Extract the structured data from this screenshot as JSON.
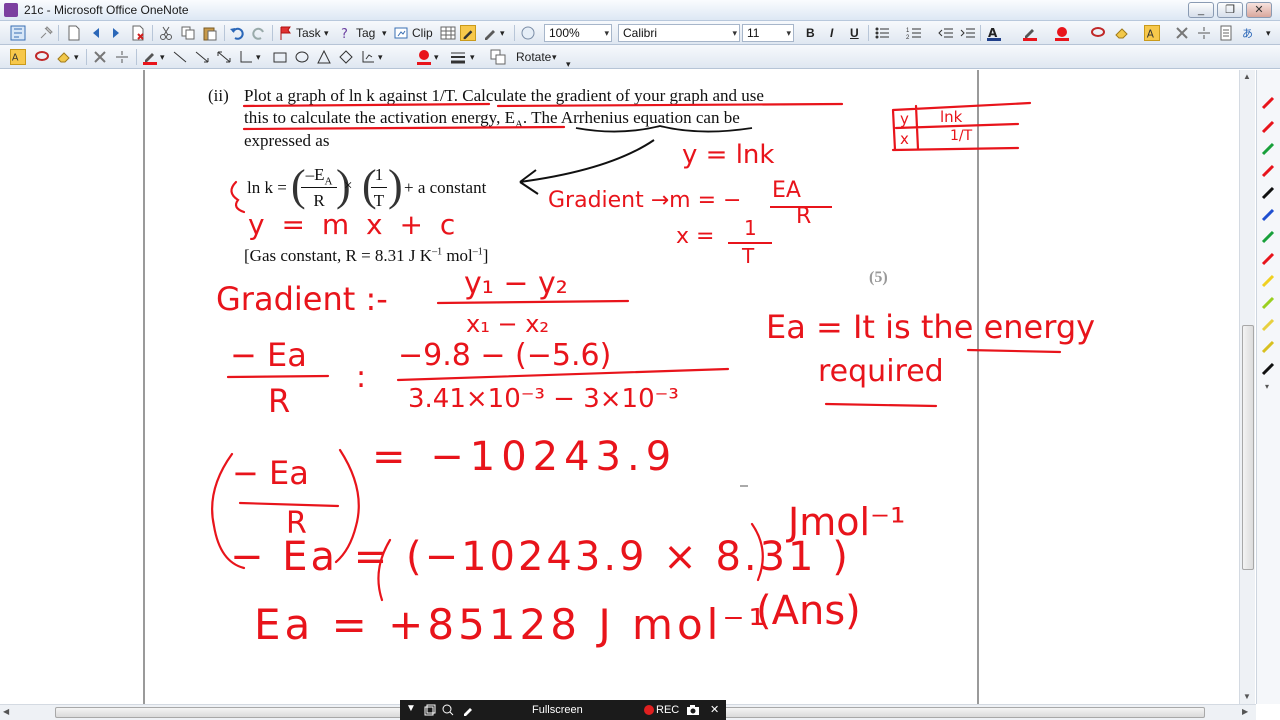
{
  "window": {
    "title": "21c  - Microsoft Office OneNote",
    "minimize": "_",
    "restore": "❐",
    "close": "✕"
  },
  "toolbar1": {
    "task_label": "Task",
    "tag_label": "Tag",
    "clip_label": "Clip",
    "zoom_value": "100%",
    "font_value": "Calibri",
    "size_value": "11",
    "bold": "B",
    "italic": "I",
    "underline": "U"
  },
  "toolbar2": {
    "rotate_label": "Rotate"
  },
  "document": {
    "part_label": "(ii)",
    "line1": "Plot a graph of ln k against 1/T.  Calculate the gradient of your graph and use",
    "line2": "this to calculate the activation energy, E",
    "line2_sub": "A",
    "line2_rest": ".  The Arrhenius equation can be",
    "line3": "expressed as",
    "eq_lnk": "ln k =",
    "eq_num": "–E",
    "eq_num_sub": "A",
    "eq_den": "R",
    "eq_times": "×",
    "eq_one": "1",
    "eq_T": "T",
    "eq_plus": "+ a constant",
    "gas_constant": "[Gas constant, R = 8.31 J K",
    "gas_exp1": "–1",
    "gas_mol": " mol",
    "gas_exp2": "–1",
    "gas_close": "]",
    "marks": "(5)"
  },
  "ink": {
    "table_y": "y",
    "table_x": "x",
    "table_lnk": "lnk",
    "table_1T": "1/T",
    "y_eq": "y = lnk",
    "m_label": "Gradient →m = −",
    "m_num": "EA",
    "m_den": "R",
    "x_eq": "x =",
    "x_num": "1",
    "x_den": "T",
    "ymxc": "y = m  x + c",
    "gradient_label": "Gradient :-",
    "grad_num": "y₁ − y₂",
    "grad_den": "x₁ − x₂",
    "ea_def": "Ea = It is the energy",
    "ea_def2": "required",
    "lhs_frac_num": "− Ea",
    "lhs_frac_den": "R",
    "colon": ":",
    "calc_num": "−9.8 − (−5.6)",
    "calc_den": "3.41×10⁻³ − 3×10⁻³",
    "lhs2_num": "− Ea",
    "lhs2_den": "R",
    "result1": "= −10243.9",
    "line_ea": "− Ea = (−10243.9 × 8.31 )",
    "unit1": "Jmol⁻¹",
    "final": "Ea = +85128 J mol⁻¹",
    "ans": "(Ans)"
  },
  "recorder": {
    "fullscreen_label": "Fullscreen",
    "rec_label": "REC"
  },
  "colors": {
    "ink_red": "#e8141b",
    "accent_blue": "#1f4f9c"
  }
}
